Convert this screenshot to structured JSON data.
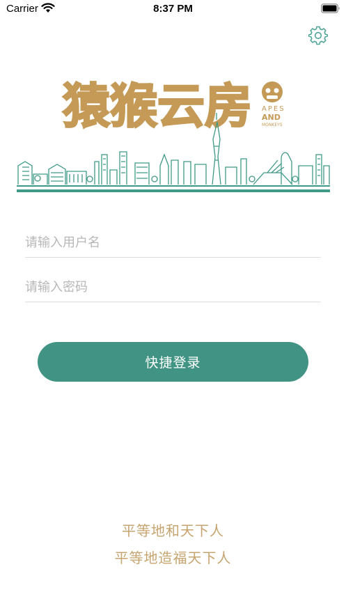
{
  "status_bar": {
    "carrier": "Carrier",
    "time": "8:37 PM"
  },
  "logo": {
    "chinese_text": "猿猴云房",
    "english_lines": [
      "APES",
      "AND",
      "MONKEYS"
    ],
    "colors": {
      "gold": "#C49A56",
      "teal": "#3E9A86"
    }
  },
  "form": {
    "username_placeholder": "请输入用户名",
    "password_placeholder": "请输入密码",
    "login_label": "快捷登录"
  },
  "slogan": {
    "line1": "平等地和天下人",
    "line2": "平等地造福天下人"
  },
  "colors": {
    "accent": "#419483",
    "slogan": "#C6A46F",
    "settings_icon": "#4FA597"
  },
  "icons": {
    "settings": "gear-icon",
    "wifi": "wifi-icon",
    "battery": "battery-icon"
  }
}
